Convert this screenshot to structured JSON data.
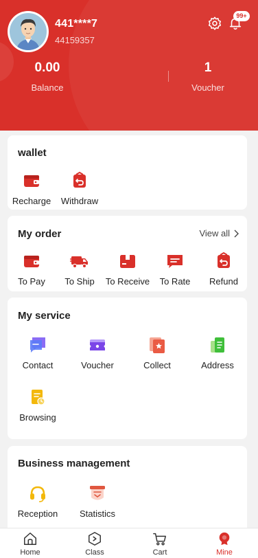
{
  "header": {
    "user_name": "441****7",
    "user_id": "44159357",
    "notification_badge": "99+",
    "balance_value": "0.00",
    "balance_label": "Balance",
    "voucher_value": "1",
    "voucher_label": "Voucher"
  },
  "wallet": {
    "title": "wallet",
    "items": [
      {
        "label": "Recharge",
        "icon": "wallet-icon"
      },
      {
        "label": "Withdraw",
        "icon": "withdraw-icon"
      }
    ]
  },
  "orders": {
    "title": "My order",
    "view_all": "View all",
    "items": [
      {
        "label": "To Pay",
        "icon": "wallet-icon"
      },
      {
        "label": "To Ship",
        "icon": "truck-icon"
      },
      {
        "label": "To Receive",
        "icon": "package-icon"
      },
      {
        "label": "To Rate",
        "icon": "comment-icon"
      },
      {
        "label": "Refund",
        "icon": "refund-icon"
      }
    ]
  },
  "service": {
    "title": "My service",
    "items": [
      {
        "label": "Contact",
        "icon": "chat-icon"
      },
      {
        "label": "Voucher",
        "icon": "ticket-icon"
      },
      {
        "label": "Collect",
        "icon": "star-folder-icon"
      },
      {
        "label": "Address",
        "icon": "address-icon"
      },
      {
        "label": "Browsing",
        "icon": "history-icon"
      }
    ]
  },
  "business": {
    "title": "Business management",
    "items": [
      {
        "label": "Reception",
        "icon": "headset-icon"
      },
      {
        "label": "Statistics",
        "icon": "stats-icon"
      }
    ]
  },
  "nav": {
    "items": [
      {
        "label": "Home",
        "icon": "home-icon"
      },
      {
        "label": "Class",
        "icon": "class-icon"
      },
      {
        "label": "Cart",
        "icon": "cart-icon"
      },
      {
        "label": "Mine",
        "icon": "mine-icon"
      }
    ],
    "active": "Mine"
  },
  "colors": {
    "accent": "#d9302a",
    "background": "#f2f2f2",
    "card": "#ffffff"
  }
}
